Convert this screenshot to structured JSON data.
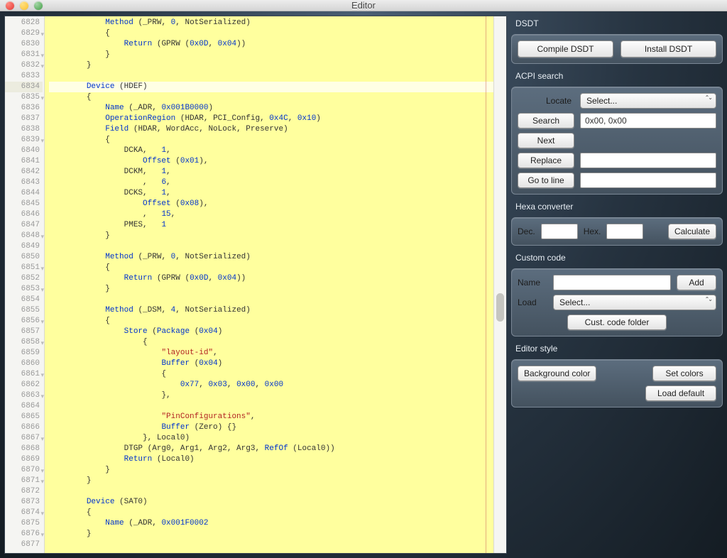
{
  "window": {
    "title": "Editor"
  },
  "code": {
    "first_line": 6828,
    "selected_line": 6834,
    "lines": [
      {
        "n": 6828,
        "fold": false,
        "html": "            <span class='tok-kw'>Method</span> <span class='tok-plain'>(_PRW,</span> <span class='tok-num'>0</span><span class='tok-plain'>, NotSerialized</span><span class='tok-plain'>)</span>"
      },
      {
        "n": 6829,
        "fold": true,
        "html": "            <span class='tok-plain'>{</span>"
      },
      {
        "n": 6830,
        "fold": false,
        "html": "                <span class='tok-kw'>Return</span> <span class='tok-plain'>(GPRW (</span><span class='tok-num'>0x0D</span><span class='tok-plain'>, </span><span class='tok-num'>0x04</span><span class='tok-plain'>))</span>"
      },
      {
        "n": 6831,
        "fold": true,
        "html": "            <span class='tok-plain'>}</span>"
      },
      {
        "n": 6832,
        "fold": true,
        "html": "        <span class='tok-plain'>}</span>"
      },
      {
        "n": 6833,
        "fold": false,
        "html": ""
      },
      {
        "n": 6834,
        "fold": false,
        "html": "        <span class='tok-kw'>Device</span> <span class='tok-plain'>(HDEF)</span>"
      },
      {
        "n": 6835,
        "fold": true,
        "html": "        <span class='tok-plain'>{</span>"
      },
      {
        "n": 6836,
        "fold": false,
        "html": "            <span class='tok-kw'>Name</span> <span class='tok-plain'>(_ADR, </span><span class='tok-num'>0x001B0000</span><span class='tok-plain'>)</span>"
      },
      {
        "n": 6837,
        "fold": false,
        "html": "            <span class='tok-kw'>OperationRegion</span> <span class='tok-plain'>(HDAR, PCI_Config, </span><span class='tok-num'>0x4C</span><span class='tok-plain'>, </span><span class='tok-num'>0x10</span><span class='tok-plain'>)</span>"
      },
      {
        "n": 6838,
        "fold": false,
        "html": "            <span class='tok-kw'>Field</span> <span class='tok-plain'>(HDAR, WordAcc, NoLock, Preserve)</span>"
      },
      {
        "n": 6839,
        "fold": true,
        "html": "            <span class='tok-plain'>{</span>"
      },
      {
        "n": 6840,
        "fold": false,
        "html": "                <span class='tok-plain'>DCKA,   </span><span class='tok-num'>1</span><span class='tok-plain'>,</span>"
      },
      {
        "n": 6841,
        "fold": false,
        "html": "                    <span class='tok-kw'>Offset</span> <span class='tok-plain'>(</span><span class='tok-num'>0x01</span><span class='tok-plain'>),</span>"
      },
      {
        "n": 6842,
        "fold": false,
        "html": "                <span class='tok-plain'>DCKM,   </span><span class='tok-num'>1</span><span class='tok-plain'>,</span>"
      },
      {
        "n": 6843,
        "fold": false,
        "html": "                    <span class='tok-plain'>,   </span><span class='tok-num'>6</span><span class='tok-plain'>,</span>"
      },
      {
        "n": 6844,
        "fold": false,
        "html": "                <span class='tok-plain'>DCKS,   </span><span class='tok-num'>1</span><span class='tok-plain'>,</span>"
      },
      {
        "n": 6845,
        "fold": false,
        "html": "                    <span class='tok-kw'>Offset</span> <span class='tok-plain'>(</span><span class='tok-num'>0x08</span><span class='tok-plain'>),</span>"
      },
      {
        "n": 6846,
        "fold": false,
        "html": "                    <span class='tok-plain'>,   </span><span class='tok-num'>15</span><span class='tok-plain'>,</span>"
      },
      {
        "n": 6847,
        "fold": false,
        "html": "                <span class='tok-plain'>PMES,   </span><span class='tok-num'>1</span>"
      },
      {
        "n": 6848,
        "fold": true,
        "html": "            <span class='tok-plain'>}</span>"
      },
      {
        "n": 6849,
        "fold": false,
        "html": ""
      },
      {
        "n": 6850,
        "fold": false,
        "html": "            <span class='tok-kw'>Method</span> <span class='tok-plain'>(_PRW, </span><span class='tok-num'>0</span><span class='tok-plain'>, NotSerialized)</span>"
      },
      {
        "n": 6851,
        "fold": true,
        "html": "            <span class='tok-plain'>{</span>"
      },
      {
        "n": 6852,
        "fold": false,
        "html": "                <span class='tok-kw'>Return</span> <span class='tok-plain'>(GPRW (</span><span class='tok-num'>0x0D</span><span class='tok-plain'>, </span><span class='tok-num'>0x04</span><span class='tok-plain'>))</span>"
      },
      {
        "n": 6853,
        "fold": true,
        "html": "            <span class='tok-plain'>}</span>"
      },
      {
        "n": 6854,
        "fold": false,
        "html": ""
      },
      {
        "n": 6855,
        "fold": false,
        "html": "            <span class='tok-kw'>Method</span> <span class='tok-plain'>(_DSM, </span><span class='tok-num'>4</span><span class='tok-plain'>, NotSerialized)</span>"
      },
      {
        "n": 6856,
        "fold": true,
        "html": "            <span class='tok-plain'>{</span>"
      },
      {
        "n": 6857,
        "fold": false,
        "html": "                <span class='tok-kw'>Store</span> <span class='tok-plain'>(</span><span class='tok-kw'>Package</span> <span class='tok-plain'>(</span><span class='tok-num'>0x04</span><span class='tok-plain'>)</span>"
      },
      {
        "n": 6858,
        "fold": true,
        "html": "                    <span class='tok-plain'>{</span>"
      },
      {
        "n": 6859,
        "fold": false,
        "html": "                        <span class='tok-str'>\"layout-id\"</span><span class='tok-plain'>,</span>"
      },
      {
        "n": 6860,
        "fold": false,
        "html": "                        <span class='tok-kw'>Buffer</span> <span class='tok-plain'>(</span><span class='tok-num'>0x04</span><span class='tok-plain'>)</span>"
      },
      {
        "n": 6861,
        "fold": true,
        "html": "                        <span class='tok-plain'>{</span>"
      },
      {
        "n": 6862,
        "fold": false,
        "html": "                            <span class='tok-num'>0x77</span><span class='tok-plain'>, </span><span class='tok-num'>0x03</span><span class='tok-plain'>, </span><span class='tok-num'>0x00</span><span class='tok-plain'>, </span><span class='tok-num'>0x00</span>"
      },
      {
        "n": 6863,
        "fold": true,
        "html": "                        <span class='tok-plain'>},</span>"
      },
      {
        "n": 6864,
        "fold": false,
        "html": ""
      },
      {
        "n": 6865,
        "fold": false,
        "html": "                        <span class='tok-str'>\"PinConfigurations\"</span><span class='tok-plain'>,</span>"
      },
      {
        "n": 6866,
        "fold": false,
        "html": "                        <span class='tok-kw'>Buffer</span> <span class='tok-plain'>(Zero) {}</span>"
      },
      {
        "n": 6867,
        "fold": true,
        "html": "                    <span class='tok-plain'>}, Local0)</span>"
      },
      {
        "n": 6868,
        "fold": false,
        "html": "                <span class='tok-plain'>DTGP (Arg0, Arg1, Arg2, Arg3, </span><span class='tok-kw'>RefOf</span> <span class='tok-plain'>(Local0))</span>"
      },
      {
        "n": 6869,
        "fold": false,
        "html": "                <span class='tok-kw'>Return</span> <span class='tok-plain'>(Local0)</span>"
      },
      {
        "n": 6870,
        "fold": true,
        "html": "            <span class='tok-plain'>}</span>"
      },
      {
        "n": 6871,
        "fold": true,
        "html": "        <span class='tok-plain'>}</span>"
      },
      {
        "n": 6872,
        "fold": false,
        "html": ""
      },
      {
        "n": 6873,
        "fold": false,
        "html": "        <span class='tok-kw'>Device</span> <span class='tok-plain'>(SAT0)</span>"
      },
      {
        "n": 6874,
        "fold": true,
        "html": "        <span class='tok-plain'>{</span>"
      },
      {
        "n": 6875,
        "fold": false,
        "html": "            <span class='tok-kw'>Name</span> <span class='tok-plain'>(_ADR, </span><span class='tok-num'>0x001F0002</span>"
      },
      {
        "n": 6876,
        "fold": true,
        "html": "        <span class='tok-plain'>}</span>"
      },
      {
        "n": 6877,
        "fold": false,
        "html": ""
      }
    ]
  },
  "panel": {
    "dsdt": {
      "title": "DSDT",
      "compile": "Compile DSDT",
      "install": "Install DSDT"
    },
    "acpi": {
      "title": "ACPI search",
      "locate_label": "Locate",
      "locate_select": "Select...",
      "search": "Search",
      "search_value": "0x00, 0x00",
      "next": "Next",
      "replace": "Replace",
      "gotoline": "Go to line"
    },
    "hexa": {
      "title": "Hexa converter",
      "dec": "Dec.",
      "hex": "Hex.",
      "calculate": "Calculate"
    },
    "custom": {
      "title": "Custom code",
      "name": "Name",
      "add": "Add",
      "load": "Load",
      "load_select": "Select...",
      "folder": "Cust. code folder"
    },
    "style": {
      "title": "Editor style",
      "bg": "Background color",
      "setcolors": "Set colors",
      "loaddefault": "Load default"
    }
  }
}
